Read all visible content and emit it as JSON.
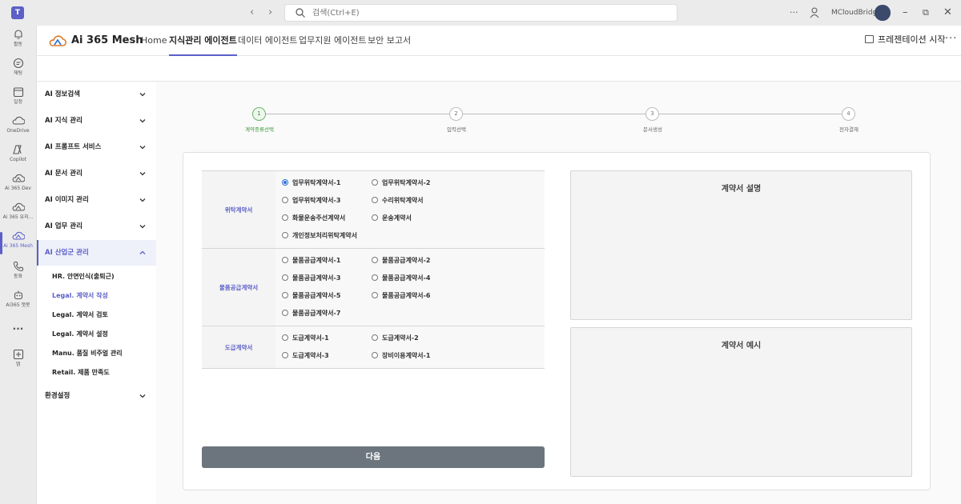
{
  "titlebar": {
    "search_placeholder": "검색(Ctrl+E)",
    "user_name": "MCloudBridge",
    "more_label": "···"
  },
  "rail": {
    "items": [
      {
        "label": "활동"
      },
      {
        "label": "채팅"
      },
      {
        "label": "일정"
      },
      {
        "label": "OneDrive"
      },
      {
        "label": "Copilot"
      },
      {
        "label": "Ai 365 Dev"
      },
      {
        "label": "Ai 365 유지..."
      },
      {
        "label": "Ai 365 Mesh"
      },
      {
        "label": "통화"
      },
      {
        "label": "Ai365 챗봇"
      },
      {
        "label": "···"
      },
      {
        "label": "앱"
      }
    ]
  },
  "header": {
    "brand": "Ai 365 Mesh",
    "tabs": [
      {
        "label": "Home"
      },
      {
        "label": "지식관리 에이전트"
      },
      {
        "label": "데이터 에이전트"
      },
      {
        "label": "업무지원 에이전트"
      },
      {
        "label": "보안 보고서"
      }
    ],
    "present_label": "프레젠테이션 시작",
    "more_label": "···"
  },
  "sidebar": {
    "menu": [
      {
        "label": "AI 정보검색"
      },
      {
        "label": "AI 지식 관리"
      },
      {
        "label": "AI 프롬프트 서비스"
      },
      {
        "label": "AI 문서 관리"
      },
      {
        "label": "AI 이미지 관리"
      },
      {
        "label": "AI 업무 관리"
      },
      {
        "label": "AI 산업군 관리"
      }
    ],
    "submenu": [
      {
        "label": "HR. 안면인식(출퇴근)"
      },
      {
        "label": "Legal. 계약서 작성"
      },
      {
        "label": "Legal. 계약서 검토"
      },
      {
        "label": "Legal. 계약서 설정"
      },
      {
        "label": "Manu. 품질 비주얼 관리"
      },
      {
        "label": "Retail. 제품 만족도"
      }
    ],
    "settings": {
      "label": "환경설정"
    }
  },
  "stepper": {
    "current": 1,
    "steps": [
      {
        "num": "1",
        "label": "계약종류선택"
      },
      {
        "num": "2",
        "label": "입력선택"
      },
      {
        "num": "3",
        "label": "문서생성"
      },
      {
        "num": "4",
        "label": "전자결재"
      }
    ]
  },
  "form": {
    "groups": [
      {
        "name": "위탁계약서",
        "options": [
          {
            "label": "업무위탁계약서-1",
            "checked": true
          },
          {
            "label": "업무위탁계약서-2"
          },
          {
            "label": "업무위탁계약서-3"
          },
          {
            "label": "수리위탁계약서"
          },
          {
            "label": "화물운송주선계약서"
          },
          {
            "label": "운송계약서"
          },
          {
            "label": "개인정보처리위탁계약서"
          }
        ]
      },
      {
        "name": "물품공급계약서",
        "options": [
          {
            "label": "물품공급계약서-1"
          },
          {
            "label": "물품공급계약서-2"
          },
          {
            "label": "물품공급계약서-3"
          },
          {
            "label": "물품공급계약서-4"
          },
          {
            "label": "물품공급계약서-5"
          },
          {
            "label": "물품공급계약서-6"
          },
          {
            "label": "물품공급계약서-7"
          }
        ]
      },
      {
        "name": "도급계약서",
        "options": [
          {
            "label": "도급계약서-1"
          },
          {
            "label": "도급계약서-2"
          },
          {
            "label": "도급계약서-3"
          },
          {
            "label": "장비이용계약서-1"
          }
        ]
      }
    ],
    "next_label": "다음"
  },
  "panels": {
    "description_title": "계약서 설명",
    "example_title": "계약서 예시"
  },
  "colors": {
    "accent": "#5b5fc7",
    "step_done": "#6bb36b",
    "button": "#6c757d"
  }
}
